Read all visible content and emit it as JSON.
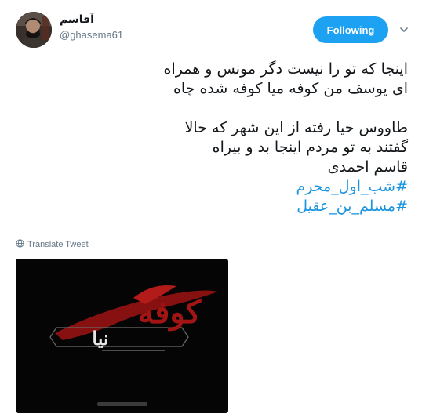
{
  "user": {
    "name": "آقاسم",
    "handle": "@ghasema61"
  },
  "follow_button": {
    "label": "Following"
  },
  "tweet": {
    "lines": [
      "اینجا که تو را نیست دگر مونس و همراه",
      "ای یوسف من کوفه میا کوفه شده چاه",
      "طاووس حیا رفته از این شهر که حالا",
      "گفتند به تو مردم اینجا بد و بیراه",
      "قاسم احمدی"
    ],
    "hashtags": [
      "#شب_اول_محرم",
      "#مسلم_بن_عقیل"
    ]
  },
  "translate_label": "Translate Tweet",
  "media": {
    "title_word": "کوفه",
    "subtitle_word": "نیا"
  },
  "colors": {
    "follow_bg": "#1da1f2",
    "hashtag": "#1b95e0",
    "muted": "#657786",
    "media_red": "#9a1414"
  },
  "icons": {
    "caret": "chevron-down-icon",
    "globe": "globe-icon"
  }
}
